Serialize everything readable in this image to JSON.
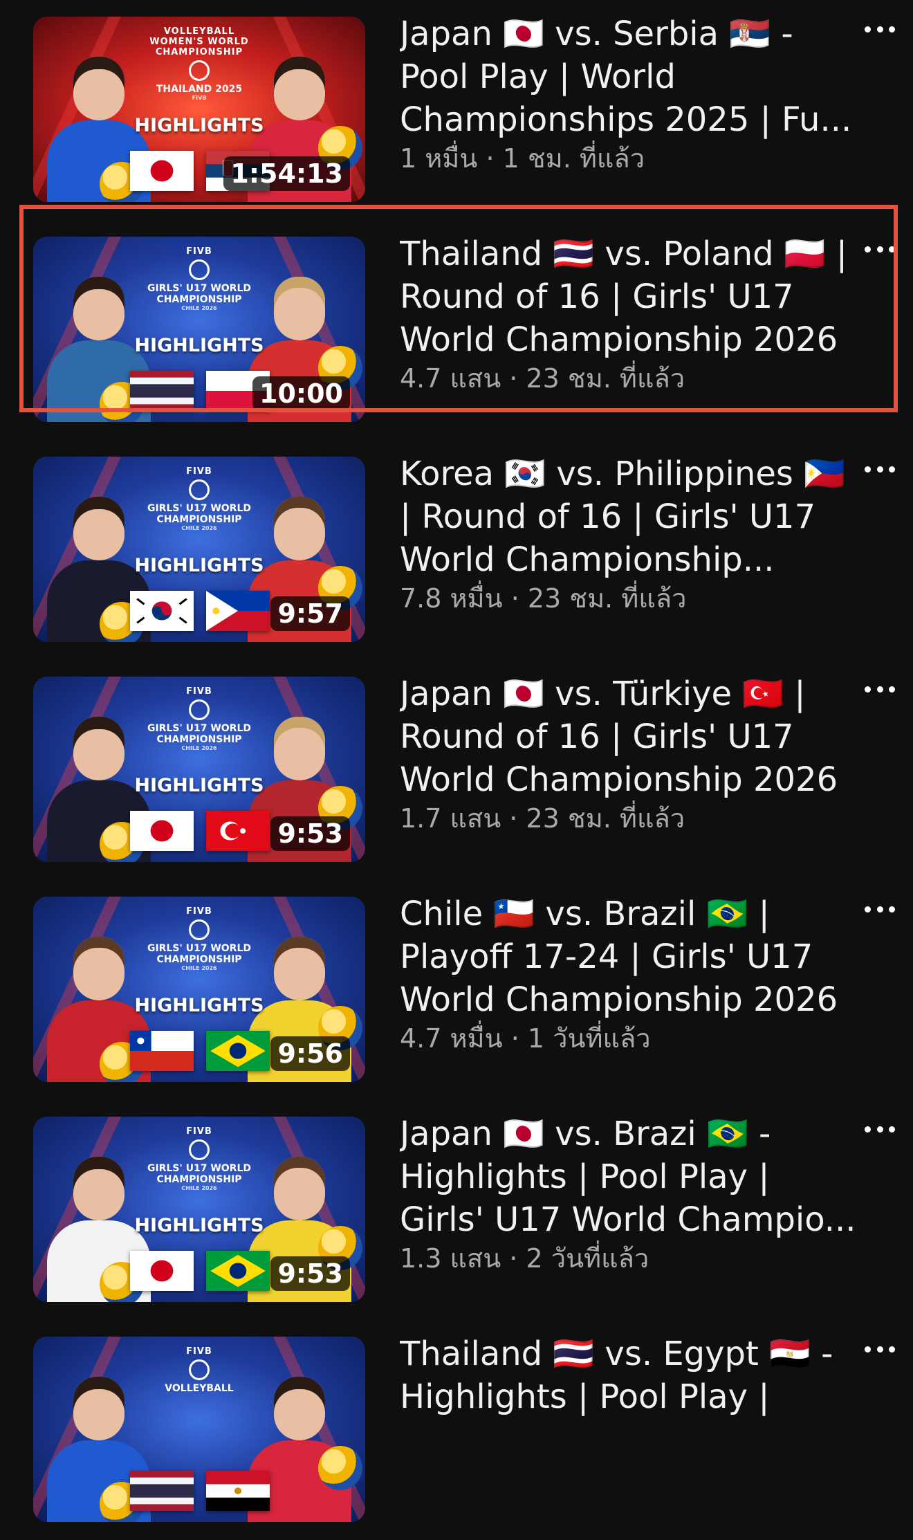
{
  "videos": [
    {
      "title": "Japan 🇯🇵 vs. Serbia 🇷🇸 - Pool Play | World Championships 2025 | Fu...",
      "views": "1 หมื่น",
      "age": "1 ชม. ที่แล้ว",
      "separator": "·",
      "duration": "1:54:13",
      "badge": "HIGHLIGHTS",
      "logo_top": "VOLLEYBALL WOMEN'S WORLD CHAMPIONSHIP",
      "logo_main": "THAILAND 2025",
      "logo_sub": "FIVB",
      "selected": false
    },
    {
      "title": "Thailand 🇹🇭 vs. Poland 🇵🇱 | Round of 16 | Girls' U17 World Championship 2026",
      "views": "4.7 แสน",
      "age": "23 ชม. ที่แล้ว",
      "separator": "·",
      "duration": "10:00",
      "badge": "HIGHLIGHTS",
      "logo_top": "FIVB",
      "logo_main": "GIRLS' U17 WORLD CHAMPIONSHIP",
      "logo_sub": "CHILE 2026",
      "selected": true
    },
    {
      "title": "Korea 🇰🇷 vs. Philippines 🇵🇭 | Round of 16 | Girls' U17 World Championship...",
      "views": "7.8 หมื่น",
      "age": "23 ชม. ที่แล้ว",
      "separator": "·",
      "duration": "9:57",
      "badge": "HIGHLIGHTS",
      "logo_top": "FIVB",
      "logo_main": "GIRLS' U17 WORLD CHAMPIONSHIP",
      "logo_sub": "CHILE 2026",
      "selected": false
    },
    {
      "title": "Japan 🇯🇵 vs. Türkiye 🇹🇷 | Round of 16 | Girls' U17 World Championship 2026",
      "views": "1.7 แสน",
      "age": "23 ชม. ที่แล้ว",
      "separator": "·",
      "duration": "9:53",
      "badge": "HIGHLIGHTS",
      "logo_top": "FIVB",
      "logo_main": "GIRLS' U17 WORLD CHAMPIONSHIP",
      "logo_sub": "CHILE 2026",
      "selected": false
    },
    {
      "title": "Chile 🇨🇱 vs. Brazil 🇧🇷 | Playoff 17-24 | Girls' U17 World Championship 2026",
      "views": "4.7 หมื่น",
      "age": "1 วันที่แล้ว",
      "separator": "·",
      "duration": "9:56",
      "badge": "HIGHLIGHTS",
      "logo_top": "FIVB",
      "logo_main": "GIRLS' U17 WORLD CHAMPIONSHIP",
      "logo_sub": "CHILE 2026",
      "selected": false
    },
    {
      "title": "Japan 🇯🇵 vs. Brazi 🇧🇷 - Highlights | Pool Play | Girls' U17 World Champio...",
      "views": "1.3 แสน",
      "age": "2 วันที่แล้ว",
      "separator": "·",
      "duration": "9:53",
      "badge": "HIGHLIGHTS",
      "logo_top": "FIVB",
      "logo_main": "GIRLS' U17 WORLD CHAMPIONSHIP",
      "logo_sub": "CHILE 2026",
      "selected": false
    },
    {
      "title": "Thailand 🇹🇭 vs. Egypt 🇪🇬 - Highlights | Pool Play |",
      "views": "",
      "age": "",
      "separator": "",
      "duration": "",
      "badge": "",
      "logo_top": "FIVB",
      "logo_main": "VOLLEYBALL",
      "logo_sub": "",
      "selected": false
    }
  ],
  "colors": {
    "background": "#0f0f0f",
    "title_text": "#f1f1f1",
    "meta_text": "#aaaaaa",
    "selection_border": "#e5533f"
  },
  "icons": {
    "more": "more-vert-icon"
  }
}
